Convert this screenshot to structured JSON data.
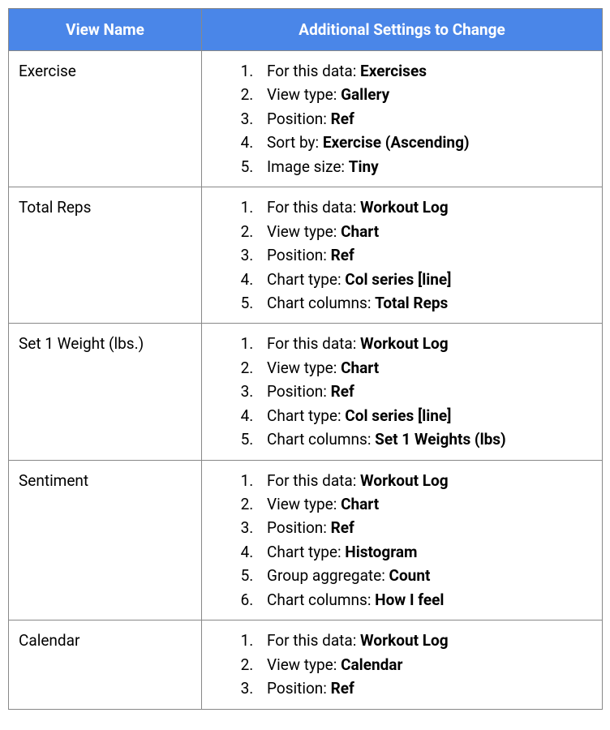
{
  "headers": {
    "view_name": "View Name",
    "settings": "Additional Settings to Change"
  },
  "rows": [
    {
      "name": "Exercise",
      "items": [
        {
          "label": "For this data:",
          "value": "Exercises"
        },
        {
          "label": "View type:",
          "value": "Gallery"
        },
        {
          "label": "Position:",
          "value": "Ref"
        },
        {
          "label": "Sort by:",
          "value": "Exercise (Ascending)"
        },
        {
          "label": "Image size:",
          "value": "Tiny"
        }
      ]
    },
    {
      "name": "Total Reps",
      "items": [
        {
          "label": "For this data:",
          "value": "Workout Log"
        },
        {
          "label": "View type:",
          "value": "Chart"
        },
        {
          "label": "Position:",
          "value": "Ref"
        },
        {
          "label": "Chart type:",
          "value": "Col series [line]"
        },
        {
          "label": "Chart columns:",
          "value": "Total Reps"
        }
      ]
    },
    {
      "name": "Set 1 Weight (lbs.)",
      "items": [
        {
          "label": "For this data:",
          "value": "Workout Log"
        },
        {
          "label": "View type:",
          "value": "Chart"
        },
        {
          "label": "Position:",
          "value": "Ref"
        },
        {
          "label": "Chart type:",
          "value": "Col series [line]"
        },
        {
          "label": "Chart columns:",
          "value": "Set 1 Weights (lbs)"
        }
      ]
    },
    {
      "name": "Sentiment",
      "items": [
        {
          "label": "For this data:",
          "value": "Workout Log"
        },
        {
          "label": "View type:",
          "value": "Chart"
        },
        {
          "label": "Position:",
          "value": "Ref"
        },
        {
          "label": "Chart type:",
          "value": "Histogram"
        },
        {
          "label": "Group aggregate:",
          "value": "Count"
        },
        {
          "label": "Chart columns:",
          "value": "How I feel"
        }
      ]
    },
    {
      "name": "Calendar",
      "items": [
        {
          "label": "For this data:",
          "value": "Workout Log"
        },
        {
          "label": "View type:",
          "value": "Calendar"
        },
        {
          "label": "Position:",
          "value": "Ref"
        }
      ]
    }
  ]
}
